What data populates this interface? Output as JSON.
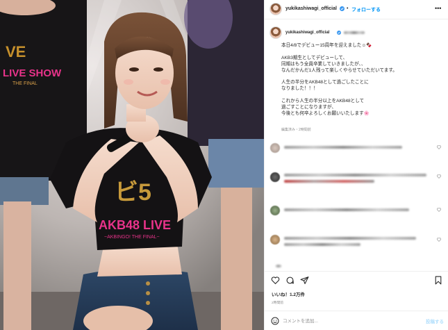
{
  "post": {
    "username": "yukikashiwagi_official",
    "follow_label": "フォローする",
    "more_label": "•••",
    "dot": "•",
    "caption_lines": [
      "本日4/8でデビュー15周年を迎えました☺︎🍫",
      "",
      "AKB3期生としてデビューして、",
      "同期はもう全員卒業していきましたが、、",
      "なんだかんだ1人残って楽しくやらせていただいてます。",
      "",
      "人生の半分をAKB48として過ごしたことに",
      "なりました！！！",
      "",
      "これから人生の半分以上をAKB48として",
      "過ごすことになりますが、",
      "今後とも何卒よろしくお願いいたします🌸"
    ],
    "caption_meta": "編集済み・2時間前",
    "likes_label": "いいね！1.2万件",
    "time_ago": "2時間前",
    "comment_placeholder": "コメントを追加...",
    "post_button": "投稿する"
  },
  "photo": {
    "shirt_text_left": "LIVE SHOW",
    "shirt_sub_left": "THE FINAL",
    "shirt_text_main": "AKB48 LIVE",
    "shirt_sub_main": "~AKBINGO! THE FINAL~"
  },
  "colors": {
    "accent": "#0095f6",
    "verified": "#3897f0",
    "shirt_pink": "#e8338a",
    "text": "#262626",
    "muted": "#8e8e8e"
  },
  "icons": [
    "verified-icon",
    "more-icon",
    "heart-icon",
    "comment-icon",
    "share-icon",
    "bookmark-icon",
    "emoji-icon"
  ]
}
